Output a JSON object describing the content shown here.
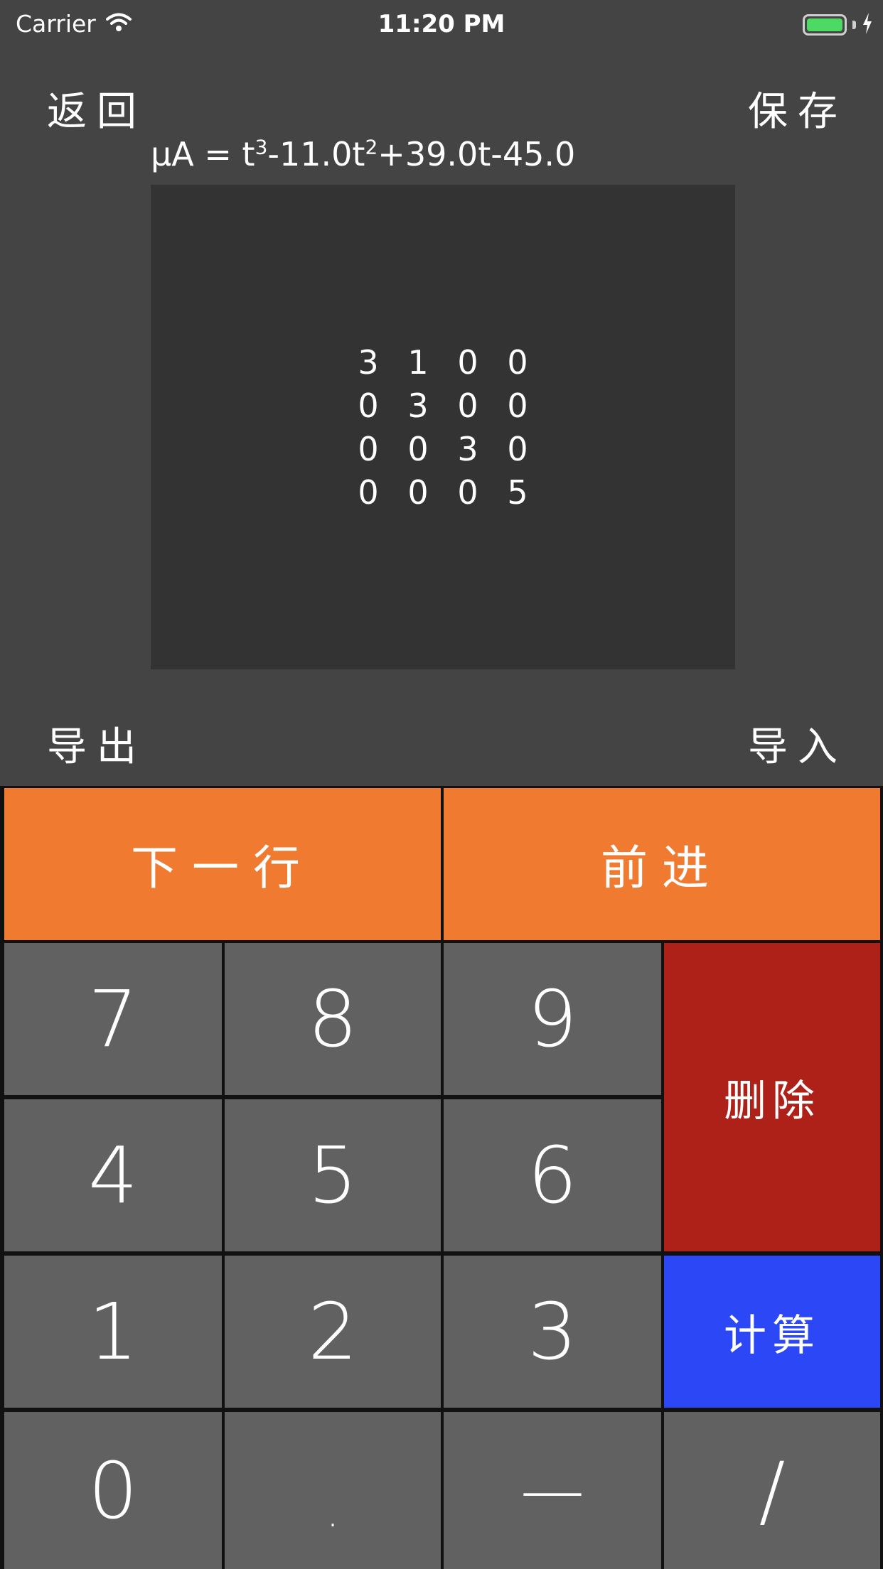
{
  "status_bar": {
    "carrier": "Carrier",
    "time": "11:20 PM",
    "battery_level": 1.0,
    "battery_color": "#4cd964",
    "wifi_icon": "wifi-icon",
    "charging_icon": "bolt-icon"
  },
  "header": {
    "back_label": "返回",
    "save_label": "保存"
  },
  "formula": {
    "prefix": "μA = t",
    "exp1": "3",
    "mid1": "-11.0t",
    "exp2": "2",
    "rest": "+39.0t-45.0"
  },
  "matrix": [
    [
      "3",
      "1",
      "0",
      "0"
    ],
    [
      "0",
      "3",
      "0",
      "0"
    ],
    [
      "0",
      "0",
      "3",
      "0"
    ],
    [
      "0",
      "0",
      "0",
      "5"
    ]
  ],
  "footer": {
    "export_label": "导出",
    "import_label": "导入"
  },
  "keypad": {
    "next_row": "下一行",
    "forward": "前进",
    "delete": "删除",
    "compute": "计算",
    "digits": {
      "k7": "7",
      "k8": "8",
      "k9": "9",
      "k4": "4",
      "k5": "5",
      "k6": "6",
      "k1": "1",
      "k2": "2",
      "k3": "3",
      "k0": "0",
      "dot": ".",
      "minus": "—",
      "slash": "/"
    }
  },
  "colors": {
    "background": "#444444",
    "panel": "#333333",
    "orange": "#ef7a30",
    "gray_key": "#616161",
    "red_key": "#ad2119",
    "blue_key": "#2c47f5"
  }
}
